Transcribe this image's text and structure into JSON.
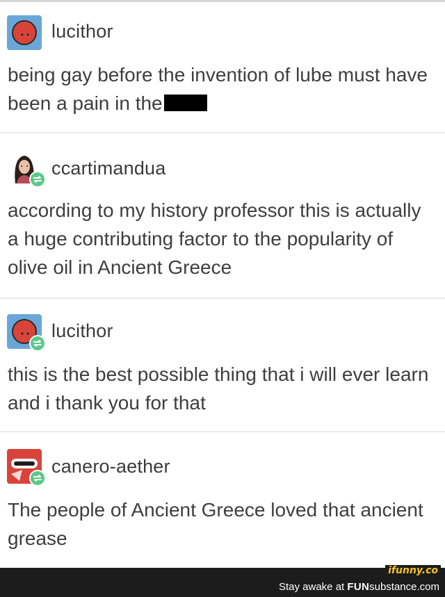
{
  "posts": [
    {
      "username": "lucithor",
      "text": "being gay before the invention of lube must have been a pain in the",
      "avatar_icon": "red-circle-avatar",
      "reblog": false
    },
    {
      "username": "ccartimandua",
      "text": "according to my history professor this is actually a huge contributing factor to the popularity of olive oil in Ancient Greece",
      "avatar_icon": "woman-portrait-avatar",
      "reblog": true
    },
    {
      "username": "lucithor",
      "text": "this is the best possible thing that i will ever learn and i thank you for that",
      "avatar_icon": "red-circle-avatar",
      "reblog": true
    },
    {
      "username": "canero-aether",
      "text": "The people of Ancient Greece loved that ancient grease",
      "avatar_icon": "red-illustration-avatar",
      "reblog": true
    }
  ],
  "watermark": {
    "logo": "ifunny.co",
    "tagline": "Stay awake at ",
    "brand_bold": "FUN",
    "brand_rest": "substance.com"
  },
  "colors": {
    "reblog_badge": "#5ac98a",
    "avatar_blue": "#6aa7d8",
    "avatar_red": "#d8443a",
    "footer_bg": "#1c1c1c",
    "logo_yellow": "#f7c520"
  }
}
